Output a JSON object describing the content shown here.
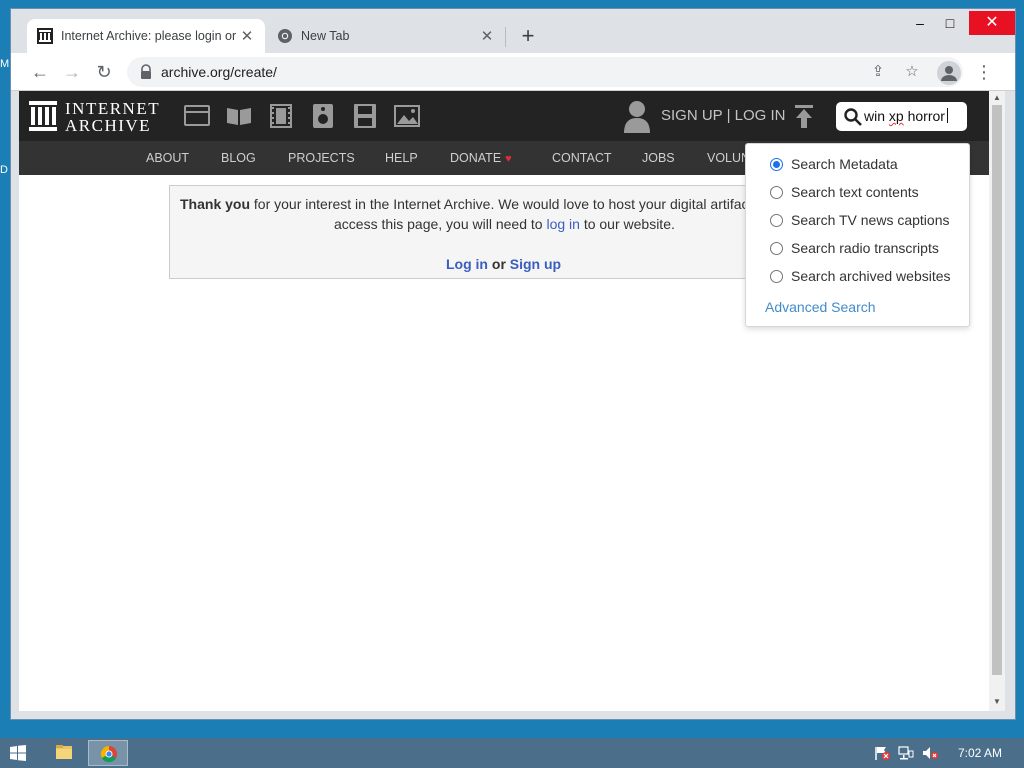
{
  "desktop": {
    "edge_glyph_top": "M",
    "edge_glyph_mid": "D"
  },
  "browser": {
    "tabs": [
      {
        "title": "Internet Archive: please login or j",
        "active": true
      },
      {
        "title": "New Tab",
        "active": false
      }
    ],
    "new_tab_label": "+",
    "window_controls": {
      "minimize": "–",
      "maximize": "□",
      "close": "✕"
    },
    "url": "archive.org/create/"
  },
  "ia": {
    "logo_line1": "INTERNET",
    "logo_line2": "ARCHIVE",
    "media_icons": [
      "web-icon",
      "texts-icon",
      "video-icon",
      "audio-icon",
      "software-icon",
      "images-icon"
    ],
    "account_text": "SIGN UP | LOG IN",
    "search": {
      "query_prefix": "win ",
      "query_misspelled": "xp",
      "query_suffix": " horror"
    },
    "nav": [
      "ABOUT",
      "BLOG",
      "PROJECTS",
      "HELP",
      "DONATE",
      "CONTACT",
      "JOBS",
      "VOLUN"
    ],
    "notice": {
      "bold_start": "Thank you",
      "line1_rest": " for your interest in the Internet Archive. We would love to host your digital artifac",
      "line2_pre": "access this page, you will need to ",
      "line2_link": "log in",
      "line2_post": " to our website.",
      "login_link": "Log in",
      "or_text": " or ",
      "signup_link": "Sign up"
    },
    "search_options": [
      {
        "label": "Search Metadata",
        "checked": true
      },
      {
        "label": "Search text contents",
        "checked": false
      },
      {
        "label": "Search TV news captions",
        "checked": false
      },
      {
        "label": "Search radio transcripts",
        "checked": false
      },
      {
        "label": "Search archived websites",
        "checked": false
      }
    ],
    "advanced_search": "Advanced Search"
  },
  "taskbar": {
    "clock": "7:02 AM"
  },
  "colors": {
    "desktop": "#1b7fb6",
    "ia_header": "#232323",
    "ia_nav": "#333333",
    "link": "#3a5fc0",
    "radio_accent": "#1a73e8"
  }
}
